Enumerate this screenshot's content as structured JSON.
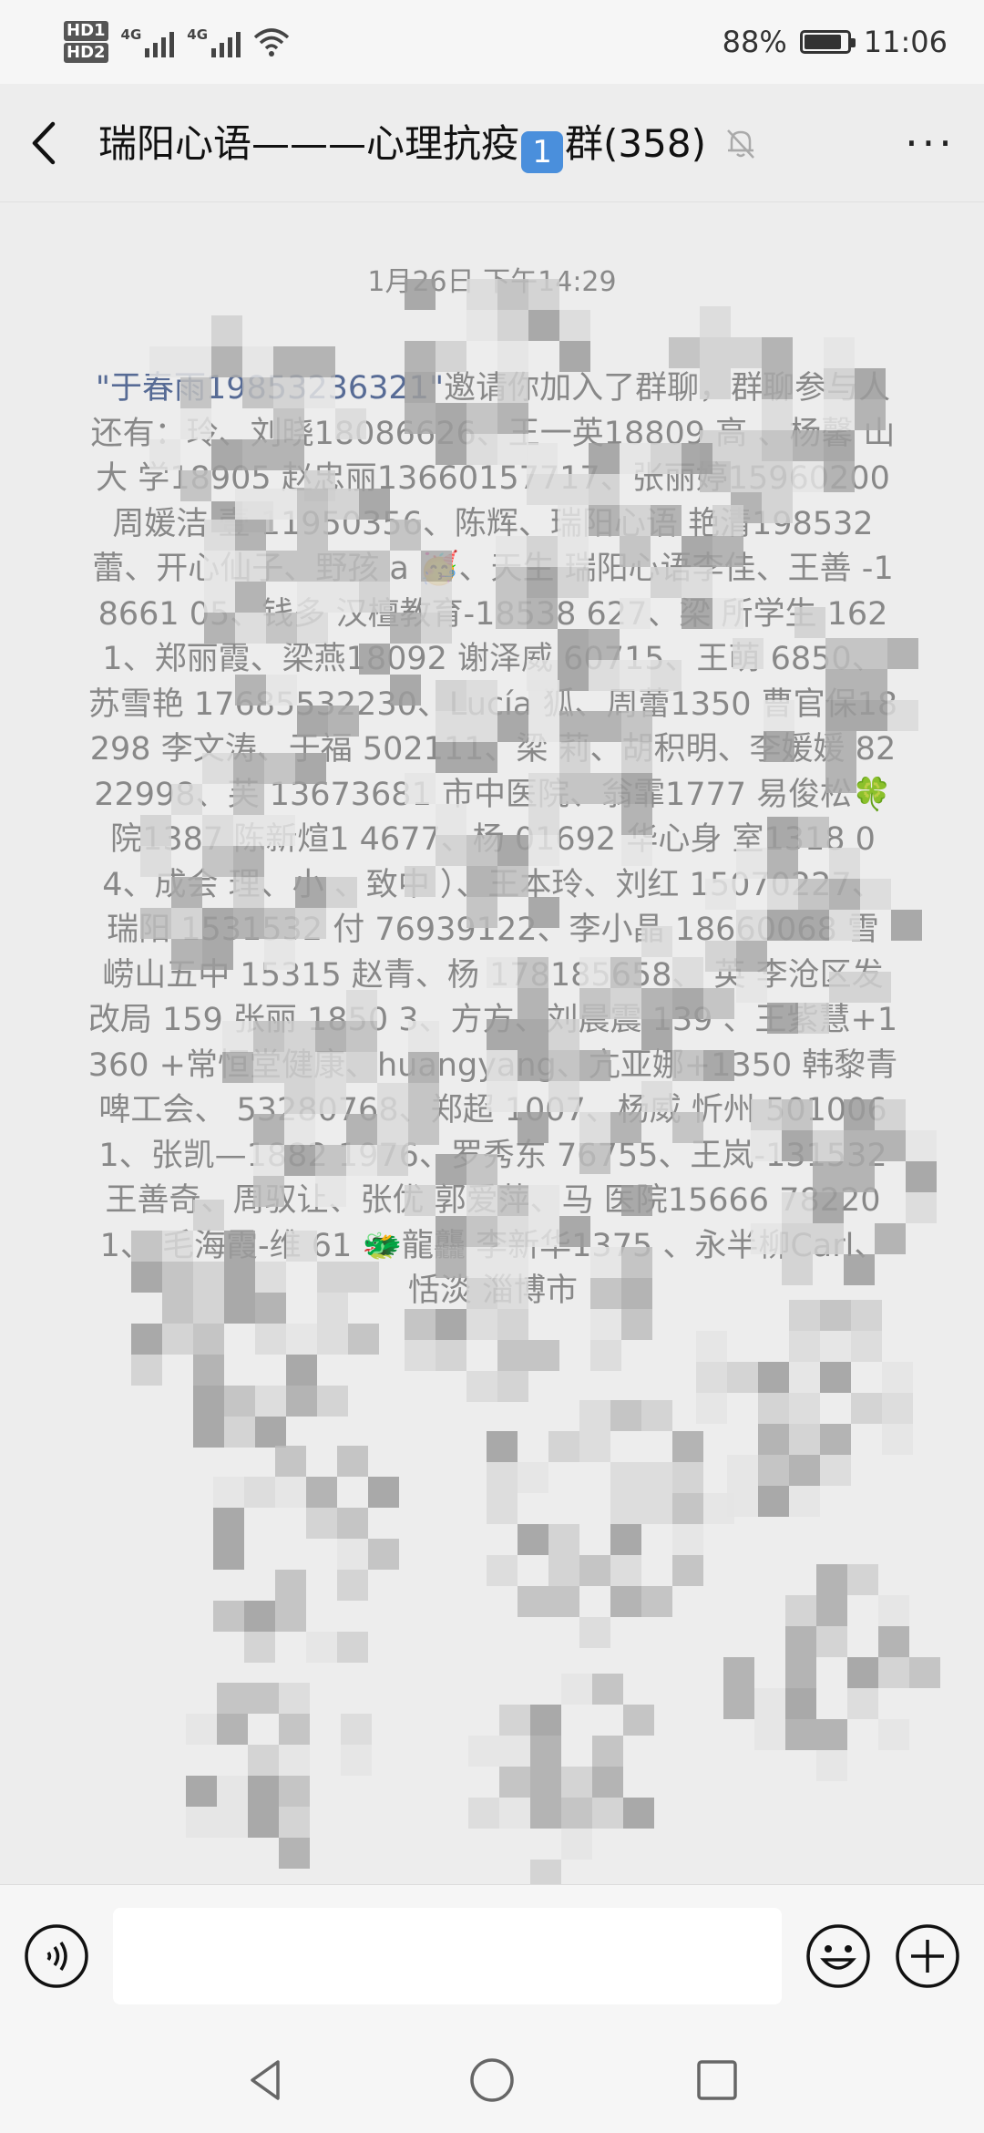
{
  "status_bar": {
    "hd1": "HD1",
    "hd2": "HD2",
    "network1": "4G",
    "network2": "4G",
    "battery_percent": "88%",
    "battery_level": 0.88,
    "time": "11:06"
  },
  "header": {
    "title_prefix": "瑞阳心语———心理抗疫",
    "title_badge": "1",
    "title_suffix": "群(358)",
    "back_icon": "chevron-left-icon",
    "mute_icon": "bell-off-icon",
    "more_label": "···"
  },
  "chat": {
    "timestamp": "1月26日 下午14:29",
    "system_message": {
      "inviter": "\"于春雨19853236321\"",
      "body": "邀请你加入了群聊，群聊参与人还有：玲、刘晓18086626、王一英18809 高 、杨馨 山大 学18905 赵忠丽13660157717、张丽婷15960200 周媛洁 壹 11950356、陈辉、瑞阳心语 艳清198532 蕾、开心仙子、野孩 a 🥳、天生 瑞阳心语李佳、王善 -18661 05、钱多 汉檀教育-18538 627、梁 所学生 1621、郑丽霞、梁燕18092 谢泽威 60715、王萌 6850、苏雪艳 17685532230、Lucía 狐、周蕾1350 曹官保18298 李文涛、于福 502111、梁 莉、胡积明、李媛媛 8222998、芙 13673681 市中医院、翁霏1777 易俊松🍀 院1387 陈新煊1 4677、杨 01692 华心身 室1318 04、成会 理、小 、致中 ）、王本玲、刘红 15070227、瑞阳 1531532 付 76939122、李小晶 18660068 雪 崂山五中 15315 赵青、杨 178185658、 英 李沧区发改局 159 张丽 1850 3、方方、刘晨震 139 、王紫慧+1360 +常恒堂健康、huangyang、亢亚娜+1350 韩黎青啤工会、 53280768、郑超 1007、杨威 忻州 5010061、张凯—1882 1976、罗秀东 76755、王岚-131532 王善奇、周驭让、张优 郭爱萍、马 医院15666 782201、 毛海霞-维 61 🐲龍龘 李新华1375 、永半柳Carl、恬淡 淄博市"
    }
  },
  "input_bar": {
    "voice_icon": "voice-icon",
    "emoji_icon": "emoji-icon",
    "plus_icon": "plus-icon",
    "input_value": ""
  },
  "system_nav": {
    "back_icon": "nav-back-icon",
    "home_icon": "nav-home-icon",
    "recents_icon": "nav-recents-icon"
  }
}
